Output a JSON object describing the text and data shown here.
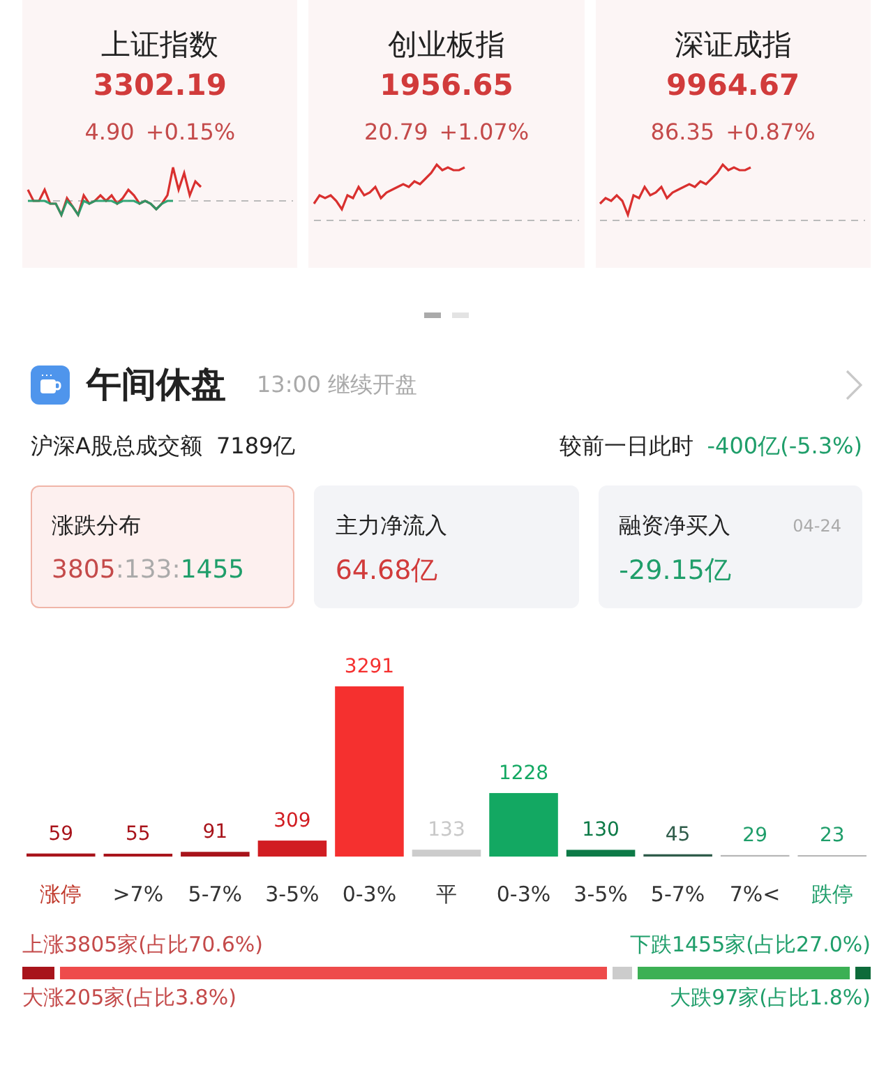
{
  "index_cards": [
    {
      "name": "上证指数",
      "value": "3302.19",
      "change": "4.90",
      "percent": "+0.15%"
    },
    {
      "name": "创业板指",
      "value": "1956.65",
      "change": "20.79",
      "percent": "+1.07%"
    },
    {
      "name": "深证成指",
      "value": "9964.67",
      "change": "86.35",
      "percent": "+0.87%"
    }
  ],
  "pager": [
    {
      "selected": true
    },
    {
      "selected": false
    }
  ],
  "session": {
    "title": "午间休盘",
    "subtitle": "13:00 继续开盘"
  },
  "turnover": {
    "label": "沪深A股总成交额",
    "value": "7189亿",
    "compare_label": "较前一日此时",
    "compare_value": "-400亿(-5.3%)"
  },
  "stat_cards": [
    {
      "title": "涨跌分布",
      "selected": true,
      "kind": "ratio",
      "up": "3805",
      "separator_1": ":",
      "flat": "133",
      "separator_2": ":",
      "down": "1455"
    },
    {
      "title": "主力净流入",
      "selected": false,
      "kind": "value",
      "value": "64.68亿",
      "color": "#d13b3b"
    },
    {
      "title": "融资净买入",
      "selected": false,
      "kind": "value",
      "value": "-29.15亿",
      "color": "#1f9e6a",
      "date": "04-24"
    }
  ],
  "distribution": {
    "chart_data": {
      "type": "bar",
      "categories": [
        "涨停",
        ">7%",
        "5-7%",
        "3-5%",
        "0-3%",
        "平",
        "0-3%",
        "3-5%",
        "5-7%",
        "7%<",
        "跌停"
      ],
      "series": [
        {
          "color": "#a8141b",
          "values": [
            59,
            55,
            91,
            null,
            null,
            null,
            null,
            null,
            null,
            null,
            null
          ]
        },
        {
          "color": "#d11d22",
          "values": [
            null,
            null,
            null,
            309,
            null,
            null,
            null,
            null,
            null,
            null,
            null
          ]
        },
        {
          "color": "#f5302f",
          "values": [
            null,
            null,
            null,
            null,
            3291,
            null,
            null,
            null,
            null,
            null,
            null
          ]
        },
        {
          "color": "#cccccc",
          "values": [
            null,
            null,
            null,
            null,
            null,
            133,
            null,
            null,
            null,
            null,
            null
          ]
        },
        {
          "color": "#13a862",
          "values": [
            null,
            null,
            null,
            null,
            null,
            null,
            1228,
            null,
            null,
            null,
            null
          ]
        },
        {
          "color": "#0d7a47",
          "values": [
            null,
            null,
            null,
            null,
            null,
            null,
            null,
            130,
            null,
            null,
            null
          ]
        },
        {
          "color": "#2f5c4a",
          "values": [
            null,
            null,
            null,
            null,
            null,
            null,
            null,
            null,
            45,
            null,
            null
          ]
        },
        {
          "color": "#b5b5b5",
          "values": [
            null,
            null,
            null,
            null,
            null,
            null,
            null,
            null,
            null,
            29,
            23
          ]
        }
      ],
      "data_labels": true
    }
  },
  "breadth": {
    "up_label": "上涨3805家(占比70.6%)",
    "down_label": "下跌1455家(占比27.0%)",
    "big_up_label": "大涨205家(占比3.8%)",
    "big_down_label": "大跌97家(占比1.8%)",
    "segments": [
      {
        "color": "#a8141b"
      },
      {
        "color": "#ee4b4b"
      },
      {
        "color": "#cccccc"
      },
      {
        "color": "#3cb054"
      },
      {
        "color": "#0d6b3a"
      }
    ]
  }
}
